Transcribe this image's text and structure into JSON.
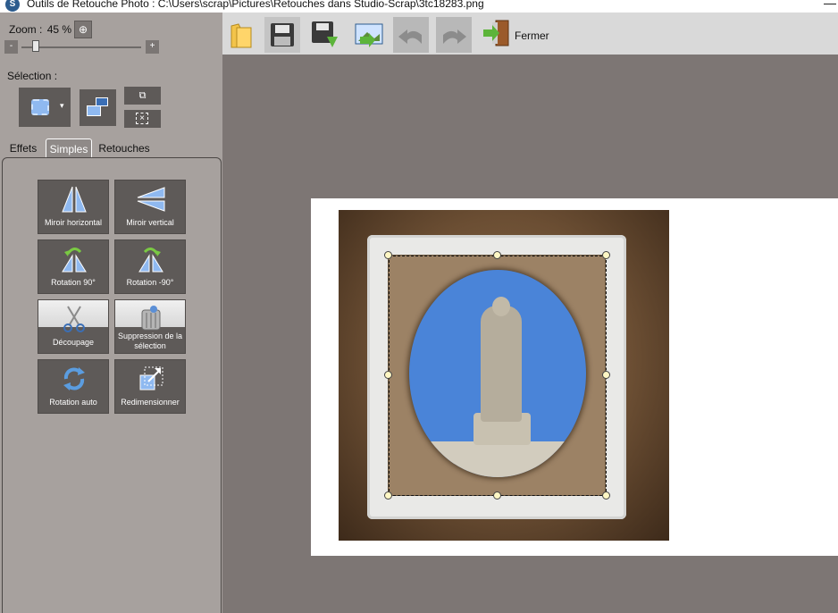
{
  "window": {
    "title": "Outils de Retouche Photo : C:\\Users\\scrap\\Pictures\\Retouches dans Studio-Scrap\\3tc18283.png",
    "minimize": "—"
  },
  "zoom": {
    "label": "Zoom :",
    "value": "45 %",
    "minus": "-",
    "plus": "+",
    "fit_icon": "⊕",
    "level": 0.45
  },
  "selection": {
    "label": "Sélection :",
    "tools": [
      "rectangle-select-icon",
      "invert-selection-icon",
      "add-selection-icon",
      "clear-selection-icon"
    ]
  },
  "tabs": {
    "effets": "Effets",
    "simples": "Simples",
    "retouches": "Retouches",
    "active": "Simples"
  },
  "tools": {
    "miroir_h": "Miroir horizontal",
    "miroir_v": "Miroir vertical",
    "rot90": "Rotation 90°",
    "rotm90": "Rotation -90°",
    "decoupage": "Découpage",
    "suppression": "Suppression de la sélection",
    "rot_auto": "Rotation auto",
    "redim": "Redimensionner"
  },
  "toolbar": {
    "buttons": [
      "folder-icon",
      "save-icon",
      "save-as-icon",
      "export-image-icon",
      "undo-icon",
      "redo-icon"
    ],
    "fermer": "Fermer"
  },
  "colors": {
    "panel": "#a7a19e",
    "button": "#5e5a58",
    "canvas": "#7d7674",
    "toolbar": "#d9d9d9",
    "sky": "#4a84d8"
  }
}
